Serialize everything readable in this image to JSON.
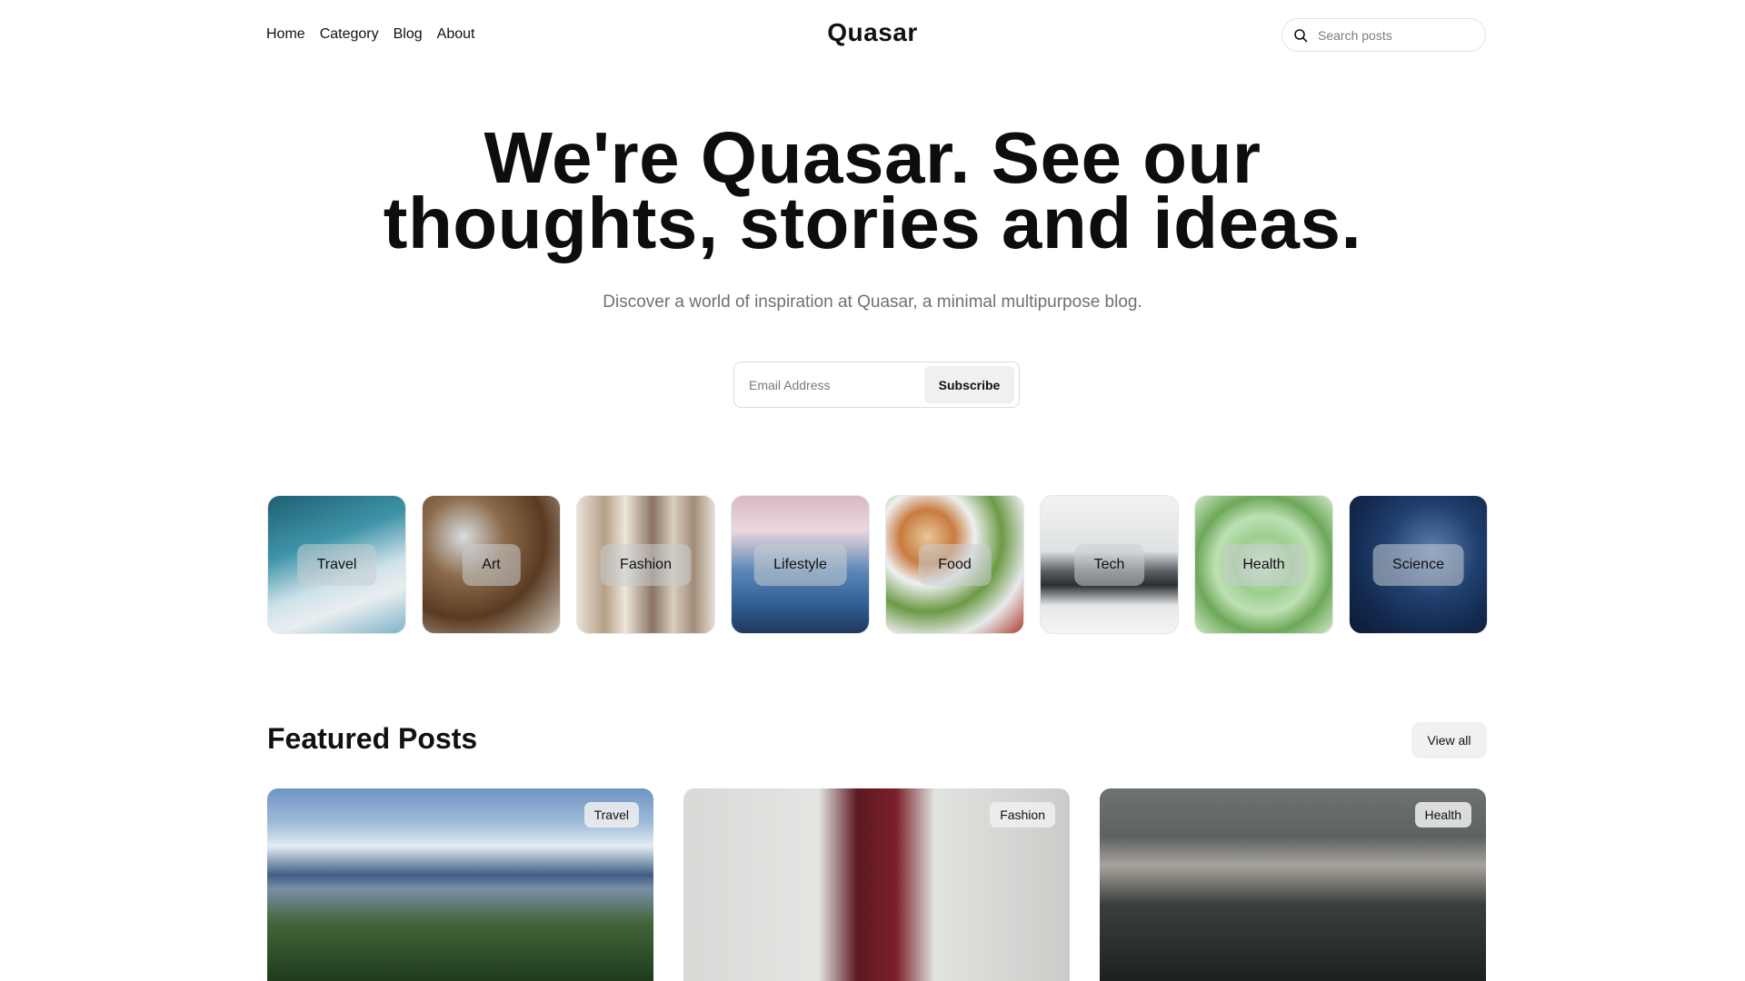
{
  "header": {
    "nav": [
      "Home",
      "Category",
      "Blog",
      "About"
    ],
    "logo": "Quasar",
    "search_placeholder": "Search posts",
    "icons": {
      "search": "search-icon"
    }
  },
  "hero": {
    "title_line1": "We're Quasar. See our",
    "title_line2": "thoughts, stories and ideas.",
    "subtitle": "Discover a world of inspiration at Quasar, a minimal multipurpose blog.",
    "email_placeholder": "Email Address",
    "subscribe_label": "Subscribe"
  },
  "categories": [
    {
      "label": "Travel"
    },
    {
      "label": "Art"
    },
    {
      "label": "Fashion"
    },
    {
      "label": "Lifestyle"
    },
    {
      "label": "Food"
    },
    {
      "label": "Tech"
    },
    {
      "label": "Health"
    },
    {
      "label": "Science"
    }
  ],
  "featured": {
    "title": "Featured Posts",
    "view_all_label": "View all",
    "posts": [
      {
        "tag": "Travel"
      },
      {
        "tag": "Fashion"
      },
      {
        "tag": "Health"
      }
    ]
  }
}
